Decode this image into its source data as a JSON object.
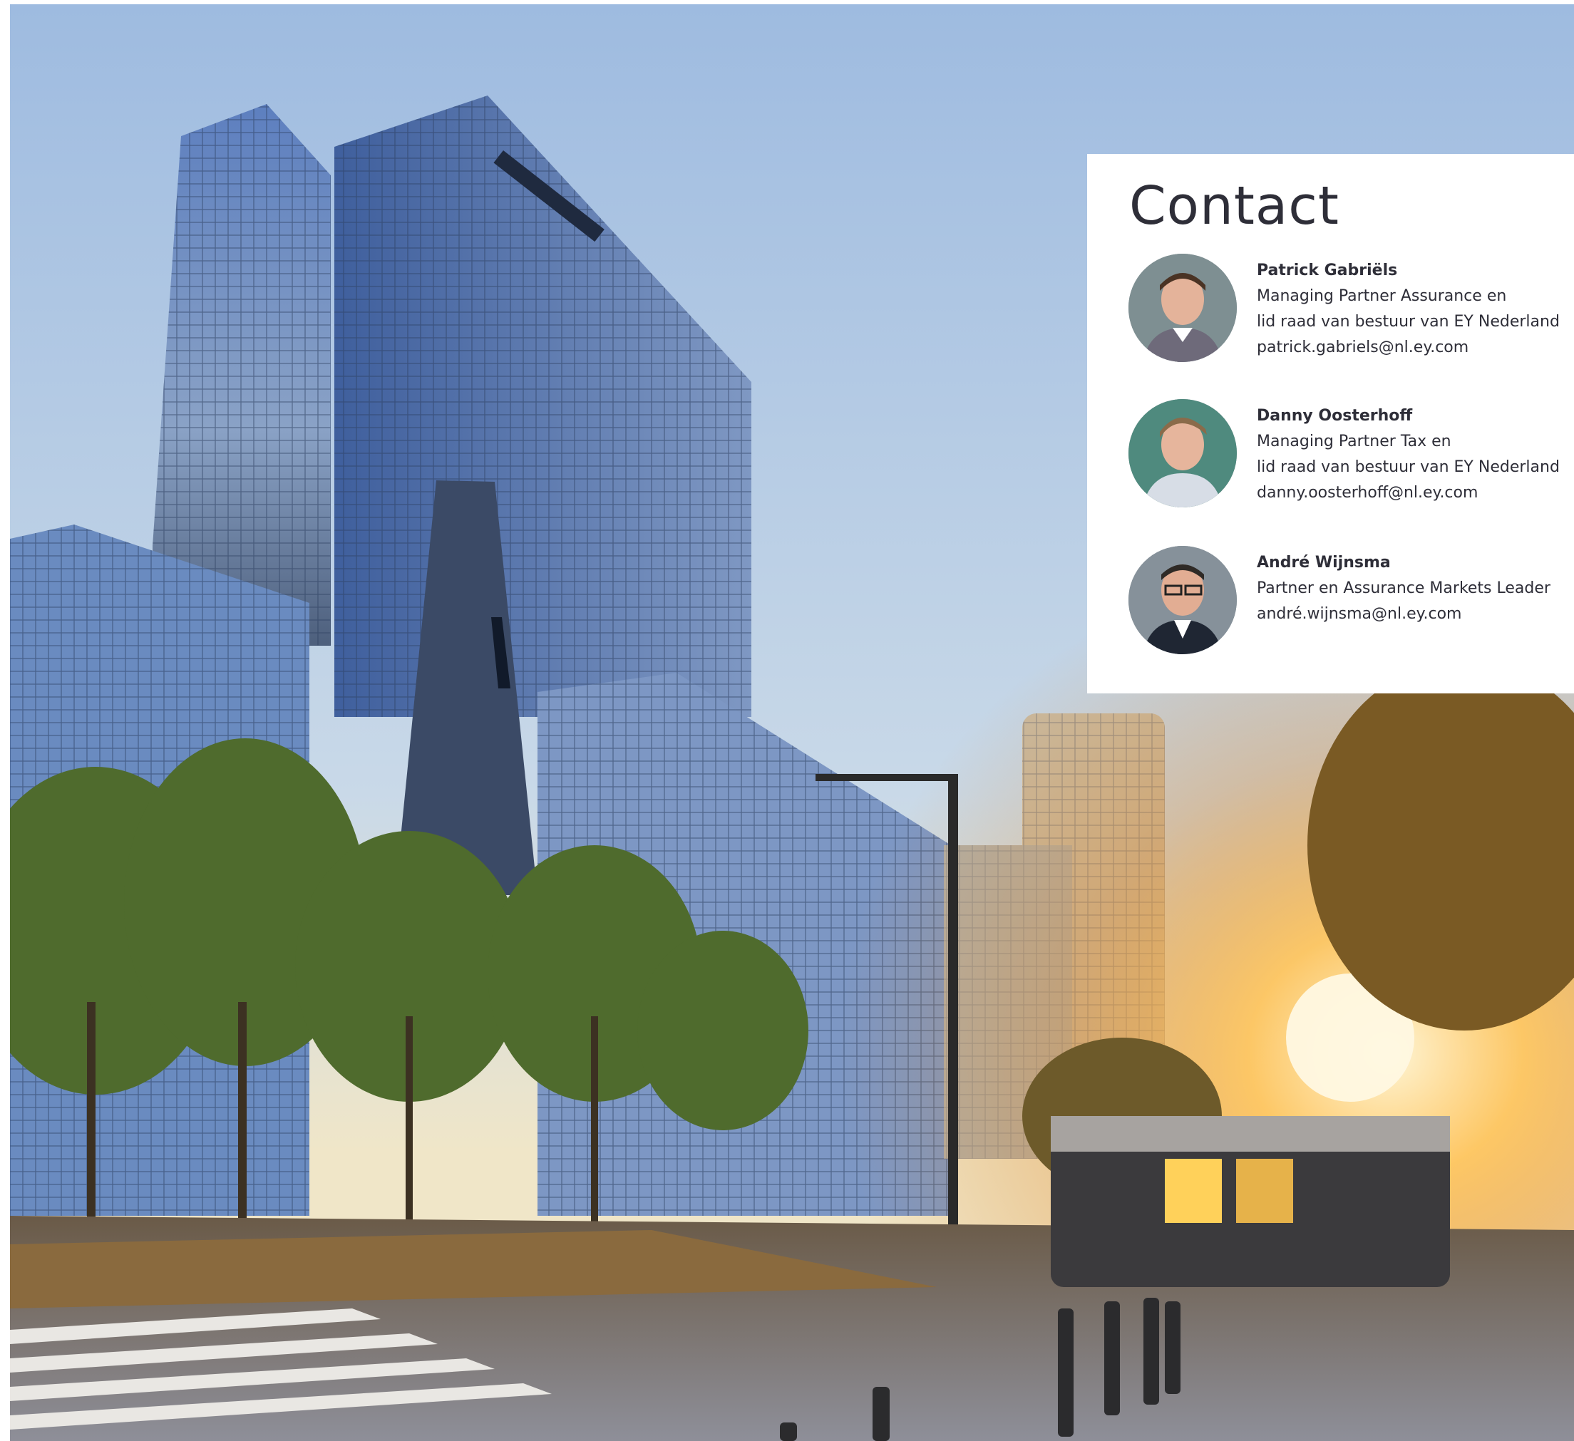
{
  "contact": {
    "title": "Contact",
    "people": [
      {
        "name": "Patrick Gabriëls",
        "role_line1": "Managing Partner Assurance en",
        "role_line2": "lid raad van bestuur van EY Nederland",
        "email": "patrick.gabriels@nl.ey.com"
      },
      {
        "name": "Danny Oosterhoff",
        "role_line1": "Managing Partner Tax en",
        "role_line2": "lid raad van bestuur van EY Nederland",
        "email": "danny.oosterhoff@nl.ey.com"
      },
      {
        "name": "André Wijnsma",
        "role_line1": "Partner en Assurance Markets Leader",
        "email": "andré.wijnsma@nl.ey.com"
      }
    ]
  },
  "colors": {
    "text": "#2e2e38",
    "card": "#ffffff",
    "sky_top": "#a9c3df",
    "sun": "#ffd27a"
  }
}
